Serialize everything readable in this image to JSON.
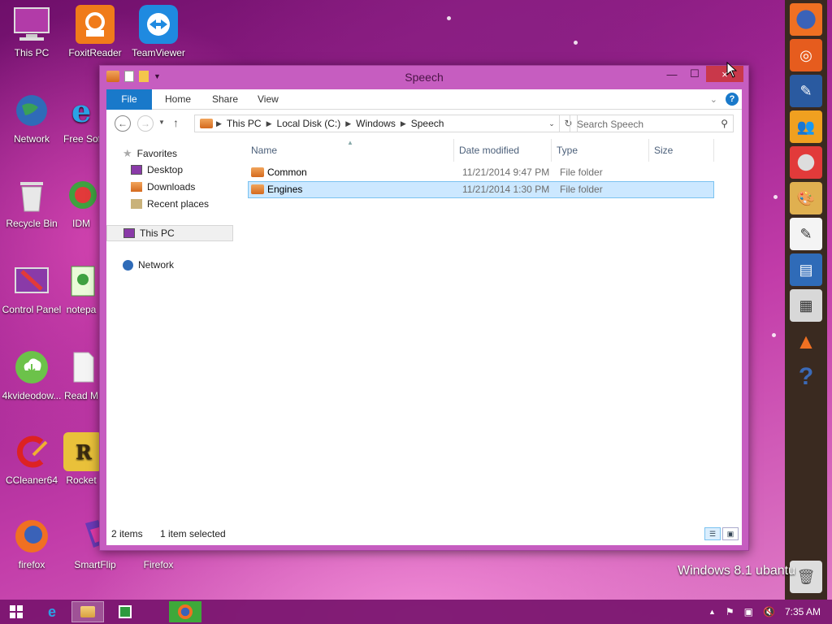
{
  "desktop": {
    "icons": [
      {
        "label": "This PC"
      },
      {
        "label": "FoxitReader"
      },
      {
        "label": "TeamViewer"
      },
      {
        "label": "Network"
      },
      {
        "label": "Free Sof"
      },
      {
        "label": "Recycle Bin"
      },
      {
        "label": "IDM"
      },
      {
        "label": "Control Panel"
      },
      {
        "label": "notepa"
      },
      {
        "label": "4kvideodow..."
      },
      {
        "label": "Read M"
      },
      {
        "label": "CCleaner64"
      },
      {
        "label": "Rocket"
      },
      {
        "label": "firefox"
      },
      {
        "label": "SmartFlip"
      },
      {
        "label": "Firefox"
      }
    ],
    "watermark": "Windows 8.1 ubantu"
  },
  "window": {
    "title": "Speech",
    "close_label": "×",
    "ribbon": {
      "file": "File",
      "home": "Home",
      "share": "Share",
      "view": "View",
      "help": "?"
    },
    "address": {
      "segments": [
        "This PC",
        "Local Disk (C:)",
        "Windows",
        "Speech"
      ]
    },
    "search": {
      "placeholder": "Search Speech"
    },
    "nav": {
      "favorites": "Favorites",
      "desktop": "Desktop",
      "downloads": "Downloads",
      "recent": "Recent places",
      "this_pc": "This PC",
      "network": "Network"
    },
    "columns": {
      "name": "Name",
      "date": "Date modified",
      "type": "Type",
      "size": "Size"
    },
    "files": [
      {
        "name": "Common",
        "date": "11/21/2014 9:47 PM",
        "type": "File folder",
        "selected": false
      },
      {
        "name": "Engines",
        "date": "11/21/2014 1:30 PM",
        "type": "File folder",
        "selected": true
      }
    ],
    "status": {
      "count": "2 items",
      "selection": "1 item selected"
    }
  },
  "taskbar": {
    "time": "7:35 AM"
  }
}
